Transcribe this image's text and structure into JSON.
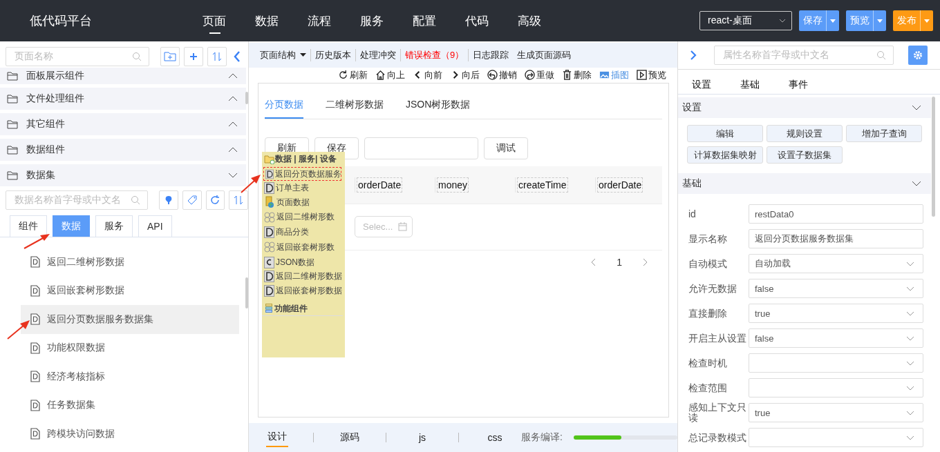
{
  "app": {
    "title": "低代码平台"
  },
  "nav": [
    {
      "label": "页面",
      "selected": true
    },
    {
      "label": "数据",
      "selected": false
    },
    {
      "label": "流程",
      "selected": false
    },
    {
      "label": "服务",
      "selected": false
    },
    {
      "label": "配置",
      "selected": false
    },
    {
      "label": "代码",
      "selected": false
    },
    {
      "label": "高级",
      "selected": false
    }
  ],
  "header_controls": {
    "platform_select": "react-桌面",
    "buttons": [
      {
        "label": "保存",
        "color": "#5b9cf8"
      },
      {
        "label": "预览",
        "color": "#5b9cf8"
      },
      {
        "label": "发布",
        "color": "#fe9a14"
      }
    ]
  },
  "left_panel": {
    "page_search": {
      "placeholder": "页面名称"
    },
    "groups": [
      {
        "label": "面板展示组件",
        "expanded": false
      },
      {
        "label": "文件处理组件",
        "expanded": false
      },
      {
        "label": "其它组件",
        "expanded": false
      },
      {
        "label": "数据组件",
        "expanded": false
      },
      {
        "label": "数据集",
        "expanded": true
      }
    ],
    "data_search": {
      "placeholder": "数据名称首字母或中文名"
    },
    "tabs": [
      {
        "label": "组件",
        "selected": false
      },
      {
        "label": "数据",
        "selected": true
      },
      {
        "label": "服务",
        "selected": false
      },
      {
        "label": "API",
        "selected": false
      }
    ],
    "datasets": [
      {
        "label": "返回二维树形数据",
        "selected": false
      },
      {
        "label": "返回嵌套树形数据",
        "selected": false
      },
      {
        "label": "返回分页数据服务数据集",
        "selected": true
      },
      {
        "label": "功能权限数据",
        "selected": false
      },
      {
        "label": "经济考核指标",
        "selected": false
      },
      {
        "label": "任务数据集",
        "selected": false
      },
      {
        "label": "跨模块访问数据",
        "selected": false
      }
    ]
  },
  "editor": {
    "toolbar": [
      {
        "label": "页面结构",
        "kind": "dropdown"
      },
      {
        "label": "历史版本",
        "kind": "plain"
      },
      {
        "label": "处理冲突",
        "kind": "plain"
      },
      {
        "label": "错误检查（9）",
        "kind": "error"
      },
      {
        "label": "日志跟踪",
        "kind": "plain"
      },
      {
        "label": "生成页面源码",
        "kind": "plain"
      }
    ],
    "actions": [
      {
        "label": "刷新",
        "kind": "refresh",
        "selected": false
      },
      {
        "label": "向上",
        "kind": "home",
        "selected": false
      },
      {
        "label": "向前",
        "kind": "prev",
        "selected": false
      },
      {
        "label": "向后",
        "kind": "next",
        "selected": false
      },
      {
        "label": "撤销",
        "kind": "undo",
        "selected": false
      },
      {
        "label": "重做",
        "kind": "redo",
        "selected": false
      },
      {
        "label": "删除",
        "kind": "delete",
        "selected": false
      },
      {
        "label": "插图",
        "kind": "image",
        "selected": true
      },
      {
        "label": "预览",
        "kind": "preview",
        "selected": false
      }
    ],
    "canvas": {
      "tabs": [
        {
          "label": "分页数据",
          "selected": true
        },
        {
          "label": "二维树形数据",
          "selected": false
        },
        {
          "label": "JSON树形数据",
          "selected": false
        }
      ],
      "buttons": [
        "刷新",
        "保存"
      ],
      "debug_button": "调试",
      "columns": [
        "orderDate",
        "money",
        "createTime",
        "orderDate"
      ],
      "date_picker": "Selec...",
      "page": "1"
    },
    "popup": {
      "header": "数据 | 服务| 设备",
      "items": [
        {
          "label": "返回分页数据服务",
          "kind": "doc",
          "selected": true
        },
        {
          "label": "订单主表",
          "kind": "doc",
          "selected": false
        },
        {
          "label": "页面数据",
          "kind": "db",
          "selected": false
        },
        {
          "label": "返回二维树形数",
          "kind": "tree",
          "selected": false
        },
        {
          "label": "商品分类",
          "kind": "doc",
          "selected": false
        },
        {
          "label": "返回嵌套树形数",
          "kind": "tree",
          "selected": false
        },
        {
          "label": "JSON数据",
          "kind": "code",
          "selected": false
        },
        {
          "label": "返回二维树形数据",
          "kind": "doc",
          "selected": false
        },
        {
          "label": "返回嵌套树形数据",
          "kind": "doc",
          "selected": false
        }
      ],
      "group": "功能组件"
    },
    "bottom_tabs": [
      {
        "label": "设计",
        "selected": true
      },
      {
        "label": "源码",
        "selected": false
      },
      {
        "label": "js",
        "selected": false
      },
      {
        "label": "css",
        "selected": false
      }
    ],
    "compile": {
      "label": "服务编译:",
      "level": 0.46
    }
  },
  "right_panel": {
    "search": {
      "placeholder": "属性名称首字母或中文名"
    },
    "tabs": [
      "设置",
      "基础",
      "事件"
    ],
    "settings_section": {
      "title": "设置",
      "buttons": [
        "编辑",
        "规则设置",
        "增加子查询",
        "计算数据集映射",
        "设置子数据集"
      ]
    },
    "basic_section": {
      "title": "基础",
      "properties": [
        {
          "label": "id",
          "value": "restData0",
          "kind": "input"
        },
        {
          "label": "显示名称",
          "value": "返回分页数据服务数据集",
          "kind": "input"
        },
        {
          "label": "自动模式",
          "value": "自动加载",
          "kind": "select"
        },
        {
          "label": "允许无数据",
          "value": "false",
          "kind": "select"
        },
        {
          "label": "直接删除",
          "value": "true",
          "kind": "select"
        },
        {
          "label": "开启主从设置",
          "value": "false",
          "kind": "select"
        },
        {
          "label": "检查时机",
          "kind": "select"
        },
        {
          "label": "检查范围",
          "kind": "select"
        },
        {
          "label": "感知上下文只读",
          "value": "true",
          "kind": "select"
        },
        {
          "label": "总记录数模式",
          "kind": "select"
        }
      ]
    }
  }
}
